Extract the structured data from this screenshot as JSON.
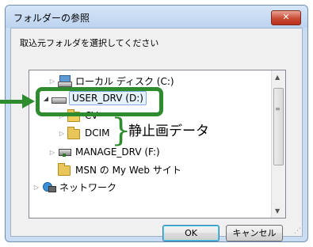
{
  "window": {
    "title": "フォルダーの参照",
    "close_label": "✕"
  },
  "instruction": "取込元フォルダを選択してください",
  "tree": {
    "items": [
      {
        "label": "ローカル ディスク (C:)"
      },
      {
        "label": "USER_DRV (D:)"
      },
      {
        "label": "CV"
      },
      {
        "label": "DCIM"
      },
      {
        "label": "MANAGE_DRV (F:)"
      },
      {
        "label": "MSN の My Web サイト"
      },
      {
        "label": "ネットワーク"
      }
    ]
  },
  "buttons": {
    "ok": "OK",
    "cancel": "キャンセル"
  },
  "annotation": {
    "label": "静止画データ"
  },
  "colors": {
    "annotation": "#2e8b2e",
    "selection": "#e5f1fb"
  }
}
